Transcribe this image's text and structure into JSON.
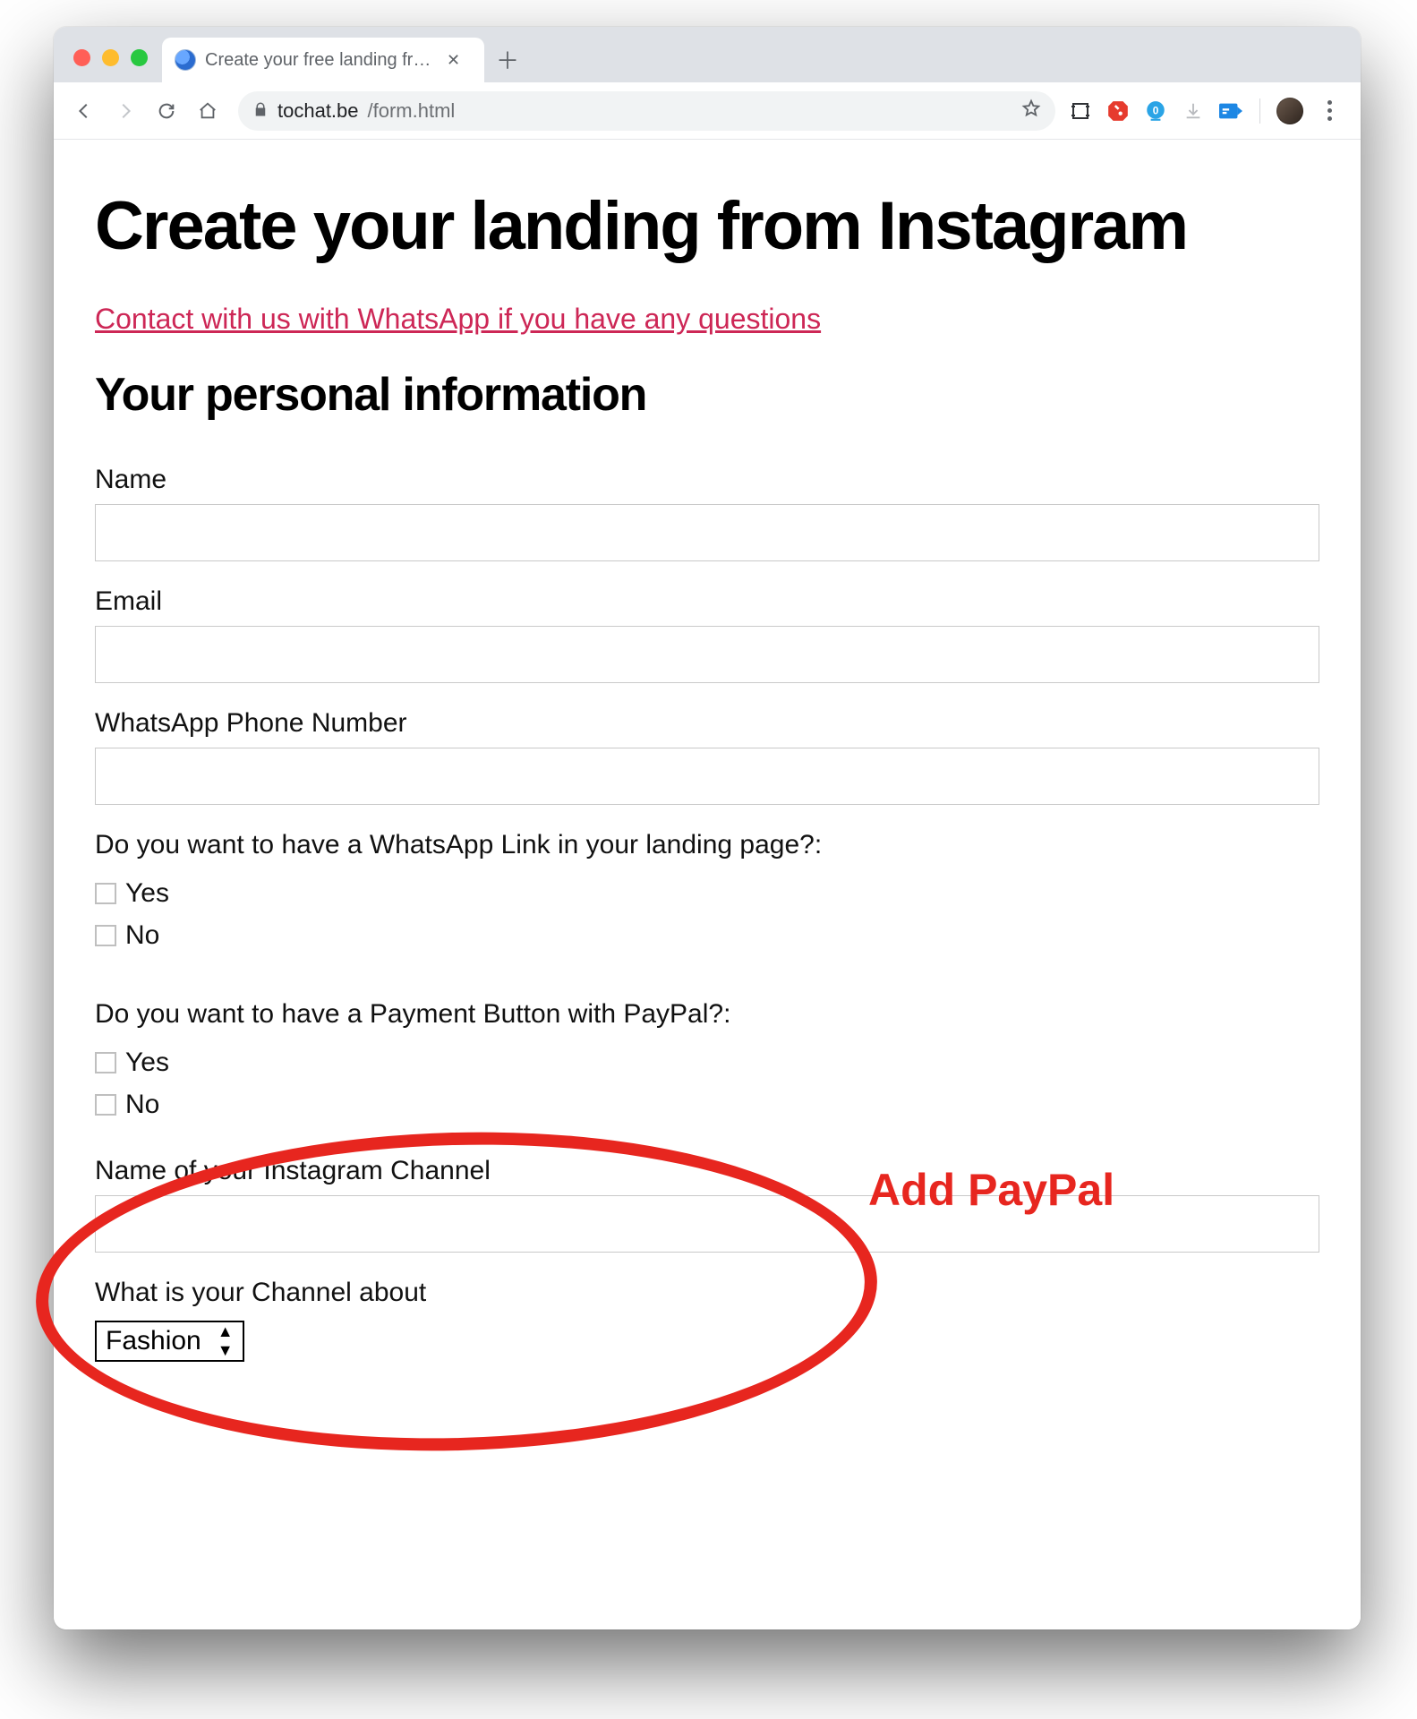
{
  "browser": {
    "tab_title": "Create your free landing from Ins",
    "url_host": "tochat.be",
    "url_path": "/form.html"
  },
  "page": {
    "h1": "Create your landing from Instagram",
    "contact_link": "Contact with us with WhatsApp if you have any questions",
    "h2": "Your personal information",
    "name_label": "Name",
    "email_label": "Email",
    "phone_label": "WhatsApp Phone Number",
    "q_whatsapp": "Do you want to have a WhatsApp Link in your landing page?:",
    "q_paypal": "Do you want to have a Payment Button with PayPal?:",
    "opt_yes": "Yes",
    "opt_no": "No",
    "instagram_channel_label": "Name of your Instagram Channel",
    "channel_about_label": "What is your Channel about",
    "channel_about_selected": "Fashion"
  },
  "annotation": {
    "label": "Add PayPal"
  }
}
